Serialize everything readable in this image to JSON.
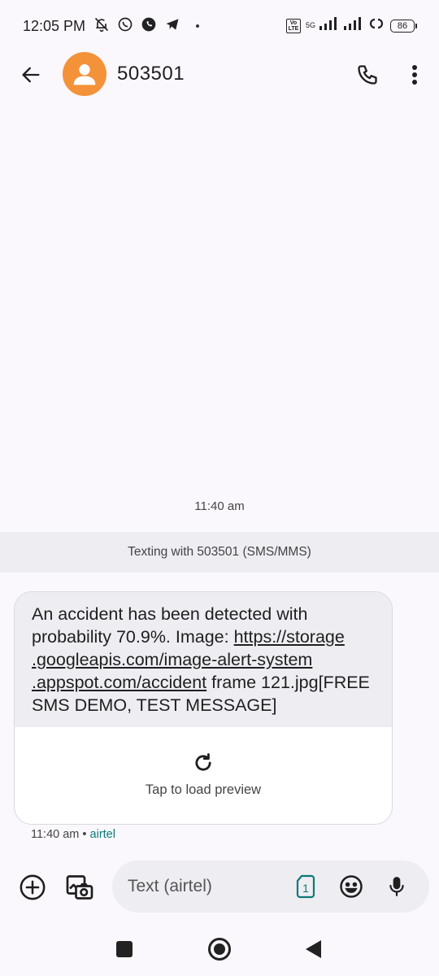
{
  "status_bar": {
    "time": "12:05 PM",
    "left_icons": [
      "bell-off-icon",
      "whatsapp-icon",
      "phone-circle-icon",
      "telegram-icon"
    ],
    "volte_label": "Vo\nLTE",
    "network_label": "5G",
    "battery": "86"
  },
  "header": {
    "contact_name": "503501",
    "avatar_color": "#f4923a"
  },
  "conversation": {
    "timestamp": "11:40 am",
    "texting_banner": "Texting with 503501 (SMS/MMS)",
    "message": {
      "text_before_link": "An accident has been detected with probability 70.9%. Image: ",
      "link_text": "https://storage.googleapis.com/image-alert-system.appspot.com/accident",
      "link_line1": "https://storage",
      "link_line2": ".googleapis.com/image-alert-system",
      "link_line3": ".appspot.com/accident",
      "text_after_link": " frame 121.jpg[FREE SMS DEMO, TEST MESSAGE]",
      "preview_label": "Tap to load preview",
      "time": "11:40 am",
      "separator": "•",
      "carrier": "airtel"
    }
  },
  "composer": {
    "placeholder": "Text (airtel)",
    "sim_number": "1"
  },
  "colors": {
    "accent_teal": "#0b7a78",
    "background": "#fbf8fd",
    "bubble": "#eeedf1"
  }
}
